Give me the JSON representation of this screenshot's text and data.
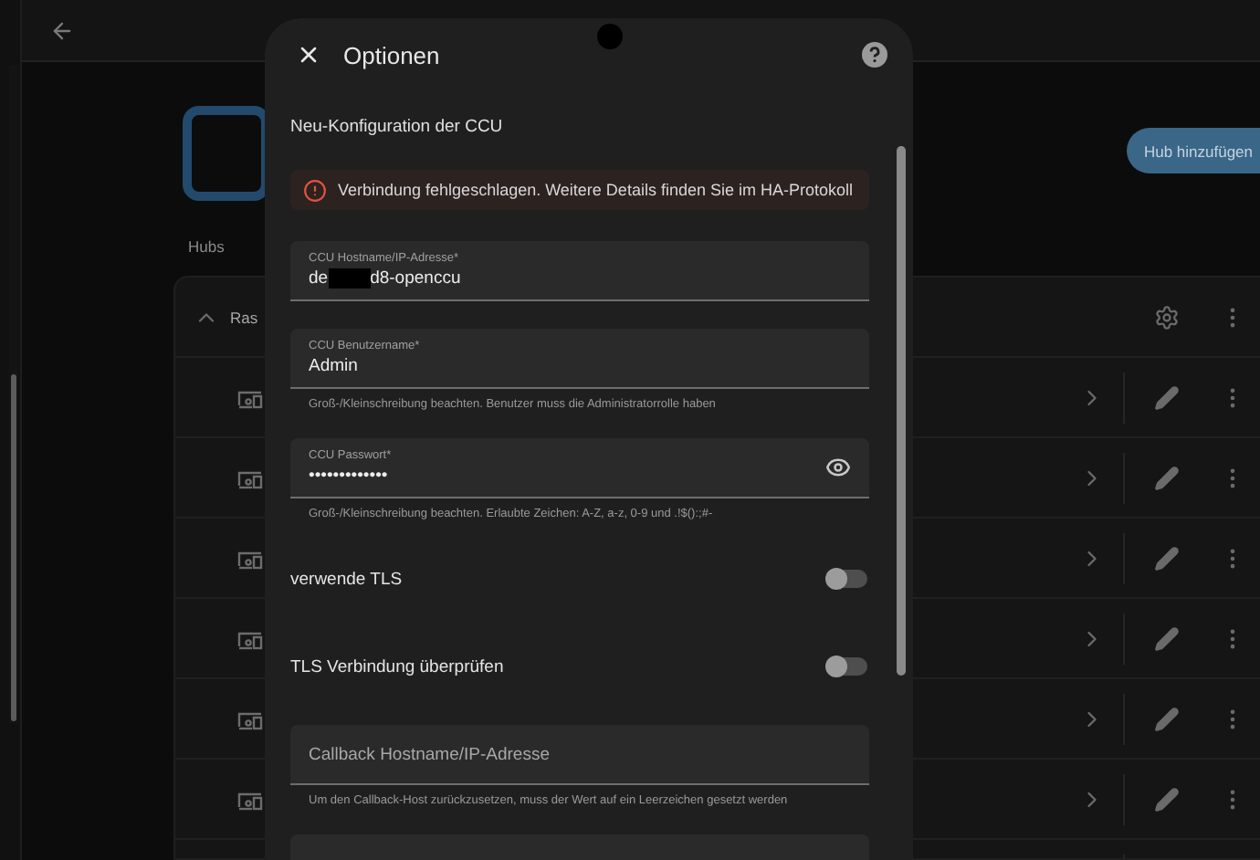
{
  "page": {
    "section_label": "Hubs",
    "add_button": "Hub hinzufügen",
    "hub": {
      "name": "Ras",
      "expanded": true
    }
  },
  "dialog": {
    "title": "Optionen",
    "heading": "Neu-Konfiguration der CCU",
    "alert": {
      "kind": "error",
      "text": "Verbindung fehlgeschlagen. Weitere Details finden Sie im HA-Protokoll"
    },
    "form": [
      {
        "kind": "field",
        "label": "CCU Hostname/IP-Adresse*",
        "value": "de",
        "redacted": true,
        "value_tail": "d8-openccu"
      },
      {
        "kind": "field",
        "label": "CCU Benutzername*",
        "value": "Admin",
        "helper": "Groß-/Kleinschreibung beachten. Benutzer muss die Administratorrolle haben"
      },
      {
        "kind": "password",
        "label": "CCU Passwort*",
        "value": "•••••••••••••",
        "helper": "Groß-/Kleinschreibung beachten. Erlaubte Zeichen: A-Z, a-z, 0-9 und .!$():;#-"
      },
      {
        "kind": "toggle",
        "label": "verwende TLS",
        "on": false
      },
      {
        "kind": "toggle",
        "label": "TLS Verbindung überprüfen",
        "on": false
      },
      {
        "kind": "field",
        "placeholder": "Callback Hostname/IP-Adresse",
        "helper": "Um den Callback-Host zurückzusetzen, muss der Wert auf ein Leerzeichen gesetzt werden"
      },
      {
        "kind": "field"
      }
    ]
  }
}
